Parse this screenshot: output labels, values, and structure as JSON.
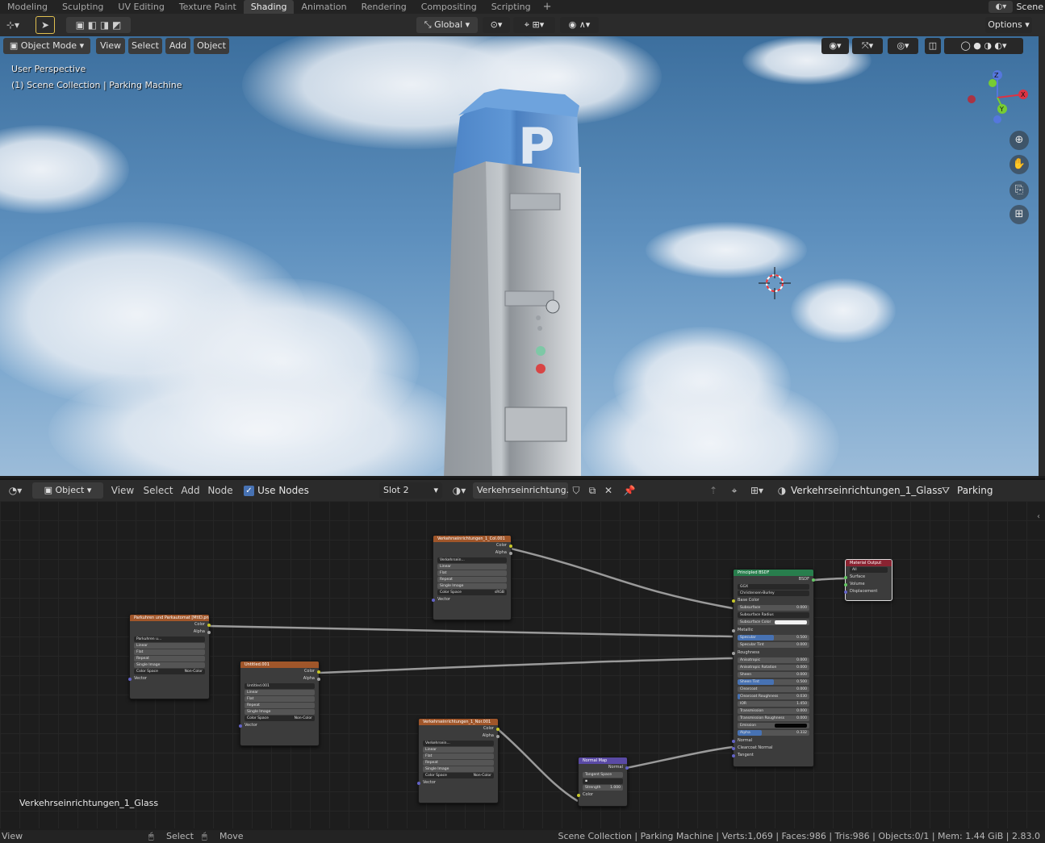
{
  "workspace_tabs": [
    "Modeling",
    "Sculpting",
    "UV Editing",
    "Texture Paint",
    "Shading",
    "Animation",
    "Rendering",
    "Compositing",
    "Scripting"
  ],
  "active_tab": "Shading",
  "add_tab": "+",
  "scene": {
    "name": "Scene"
  },
  "viewport_header": {
    "mode": "Object Mode",
    "menus": [
      "View",
      "Select",
      "Add",
      "Object"
    ],
    "transform_orientation": "Global",
    "options_label": "Options"
  },
  "viewport": {
    "perspective": "User Perspective",
    "collection_info": "(1) Scene Collection | Parking Machine",
    "sign_letter": "P",
    "gizmo": {
      "z": "Z",
      "y": "Y",
      "x": "X"
    }
  },
  "node_header": {
    "editor_type": "Object",
    "menus": [
      "View",
      "Select",
      "Add",
      "Node"
    ],
    "use_nodes_label": "Use Nodes",
    "use_nodes": true,
    "slot": "Slot 2",
    "material_field": "Verkehrseinrichtung...",
    "material_name": "Verkehrseinrichtungen_1_Glass",
    "object_name": "Parking Machine"
  },
  "nodes": {
    "tex_col": {
      "title": "Verkehrseinrichtungen_1_Col.001",
      "outputs": [
        "Color",
        "Alpha"
      ],
      "image": "Verkehrsein...",
      "interp": "Linear",
      "proj": "Flat",
      "ext": "Repeat",
      "source": "Single Image",
      "colorspace_label": "Color Space",
      "colorspace": "sRGB",
      "vector": "Vector"
    },
    "tex_park": {
      "title": "Parkuhren und Parkautomat [MtlD.png",
      "outputs": [
        "Color",
        "Alpha"
      ],
      "image": "Parkuhren u...",
      "interp": "Linear",
      "proj": "Flat",
      "ext": "Repeat",
      "source": "Single Image",
      "colorspace_label": "Color Space",
      "colorspace": "Non-Color",
      "vector": "Vector"
    },
    "tex_untitled": {
      "title": "Untitled.001",
      "outputs": [
        "Color",
        "Alpha"
      ],
      "image": "Untitled.001",
      "interp": "Linear",
      "proj": "Flat",
      "ext": "Repeat",
      "source": "Single Image",
      "colorspace_label": "Color Space",
      "colorspace": "Non-Color",
      "vector": "Vector"
    },
    "tex_nor": {
      "title": "Verkehrseinrichtungen_1_Nor.001",
      "outputs": [
        "Color",
        "Alpha"
      ],
      "image": "Verkehrsein...",
      "interp": "Linear",
      "proj": "Flat",
      "ext": "Repeat",
      "source": "Single Image",
      "colorspace_label": "Color Space",
      "colorspace": "Non-Color",
      "vector": "Vector"
    },
    "normal_map": {
      "title": "Normal Map",
      "output": "Normal",
      "space": "Tangent Space",
      "strength_label": "Strength",
      "strength": "1.000",
      "color": "Color"
    },
    "bsdf": {
      "title": "Principled BSDF",
      "output": "BSDF",
      "distribution": "GGX",
      "subsurface_method": "Christensen-Burley",
      "rows": [
        {
          "label": "Base Color",
          "kind": "socket"
        },
        {
          "label": "Subsurface",
          "value": "0.000"
        },
        {
          "label": "Subsurface Radius",
          "kind": "select"
        },
        {
          "label": "Subsurface Color",
          "kind": "white"
        },
        {
          "label": "Metallic",
          "kind": "socket"
        },
        {
          "label": "Specular",
          "value": "0.500",
          "fill": 0.5
        },
        {
          "label": "Specular Tint",
          "value": "0.000"
        },
        {
          "label": "Roughness",
          "kind": "socket"
        },
        {
          "label": "Anisotropic",
          "value": "0.000"
        },
        {
          "label": "Anisotropic Rotation",
          "value": "0.000"
        },
        {
          "label": "Sheen",
          "value": "0.000"
        },
        {
          "label": "Sheen Tint",
          "value": "0.500",
          "fill": 0.5
        },
        {
          "label": "Clearcoat",
          "value": "0.000"
        },
        {
          "label": "Clearcoat Roughness",
          "value": "0.030",
          "fill": 0.03
        },
        {
          "label": "IOR",
          "value": "1.450"
        },
        {
          "label": "Transmission",
          "value": "0.000"
        },
        {
          "label": "Transmission Roughness",
          "value": "0.000"
        },
        {
          "label": "Emission",
          "kind": "black"
        },
        {
          "label": "Alpha",
          "value": "0.332",
          "fill": 0.332
        },
        {
          "label": "Normal",
          "kind": "socket"
        },
        {
          "label": "Clearcoat Normal",
          "kind": "socket"
        },
        {
          "label": "Tangent",
          "kind": "socket"
        }
      ]
    },
    "output": {
      "title": "Material Output",
      "target": "All",
      "inputs": [
        "Surface",
        "Volume",
        "Displacement"
      ]
    }
  },
  "material_label": "Verkehrseinrichtungen_1_Glass",
  "statusbar": {
    "left": "View",
    "select": "Select",
    "move": "Move",
    "stats": "Scene Collection | Parking Machine | Verts:1,069 | Faces:986 | Tris:986 | Objects:0/1 | Mem: 1.44 GiB | 2.83.0"
  }
}
